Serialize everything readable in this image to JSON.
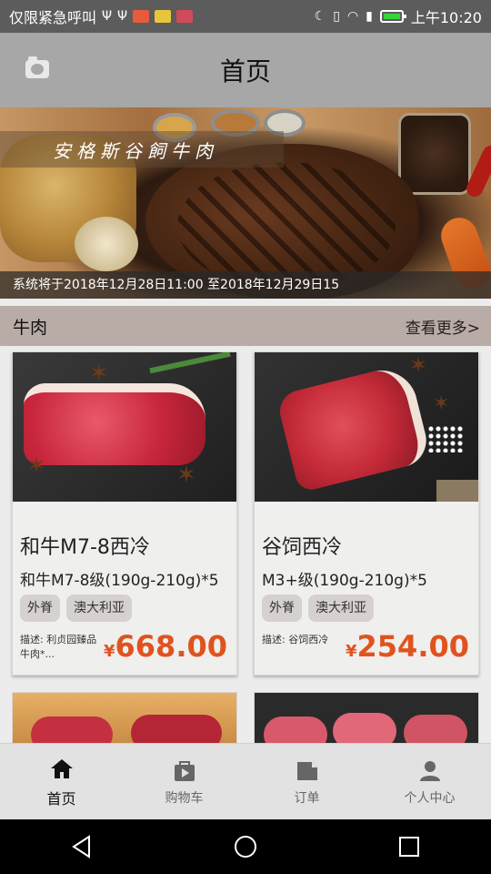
{
  "status_bar": {
    "carrier_text": "仅限紧急呼叫",
    "time": "上午10:20"
  },
  "app_bar": {
    "title": "首页",
    "camera_icon": "camera-icon"
  },
  "banner": {
    "headline": "安格斯谷飼牛肉",
    "notice": "系统将于2018年12月28日11:00 至2018年12月29日15"
  },
  "section": {
    "name": "牛肉",
    "more_label": "查看更多>"
  },
  "products": [
    {
      "title": "和牛M7-8西冷",
      "spec": "和牛M7-8级(190g-210g)*5",
      "tags": [
        "外脊",
        "澳大利亚"
      ],
      "desc": "描述: 利贞园臻品牛肉*...",
      "currency": "¥",
      "price": "668.00"
    },
    {
      "title": "谷饲西冷",
      "spec": "M3+级(190g-210g)*5",
      "tags": [
        "外脊",
        "澳大利亚"
      ],
      "desc": "描述: 谷饲西冷",
      "currency": "¥",
      "price": "254.00"
    }
  ],
  "tabbar": {
    "tabs": [
      {
        "label": "首页",
        "icon": "home-icon",
        "active": true
      },
      {
        "label": "购物车",
        "icon": "cart-icon",
        "active": false
      },
      {
        "label": "订单",
        "icon": "order-icon",
        "active": false
      },
      {
        "label": "个人中心",
        "icon": "person-icon",
        "active": false
      }
    ]
  },
  "colors": {
    "accent_price": "#e0531e",
    "section_bg": "#b9aba5",
    "appbar_bg": "#a7a7a7"
  }
}
